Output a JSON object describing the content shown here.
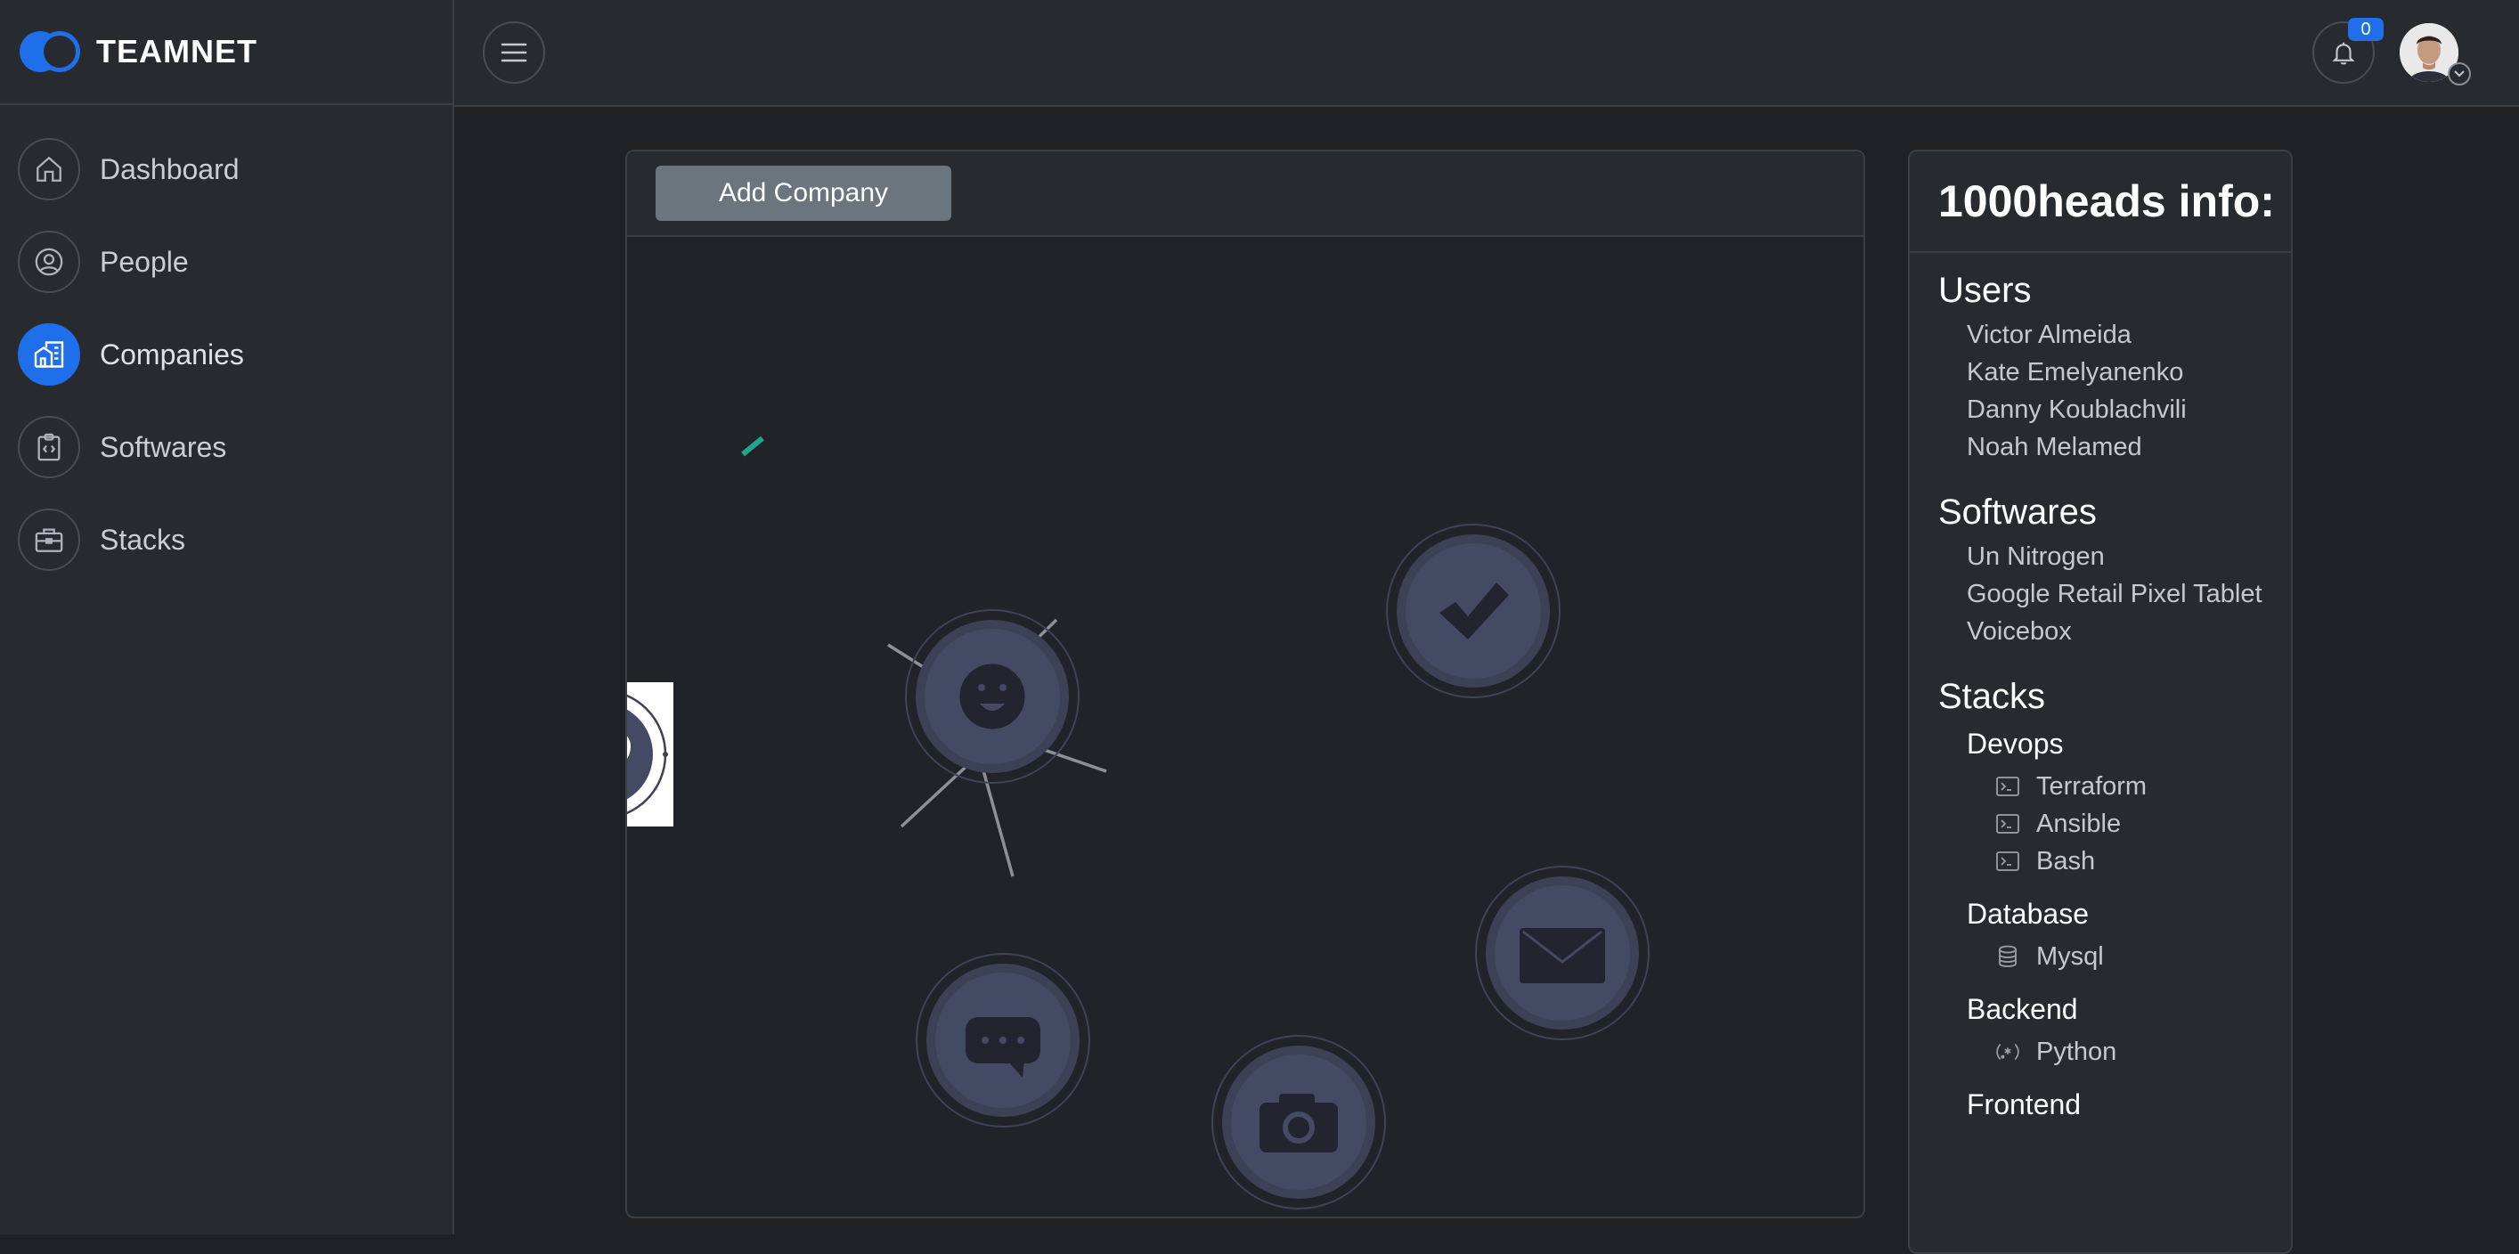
{
  "brand": {
    "name": "TEAMNET",
    "accent": "#1f6feb"
  },
  "sidebar": {
    "items": [
      {
        "label": "Dashboard",
        "icon": "home-icon",
        "active": false
      },
      {
        "label": "People",
        "icon": "user-circle-icon",
        "active": false
      },
      {
        "label": "Companies",
        "icon": "buildings-icon",
        "active": true
      },
      {
        "label": "Softwares",
        "icon": "code-clipboard-icon",
        "active": false
      },
      {
        "label": "Stacks",
        "icon": "briefcase-icon",
        "active": false
      }
    ]
  },
  "topbar": {
    "menu_icon": "hamburger-icon",
    "notifications": {
      "icon": "bell-icon",
      "count": "0"
    },
    "avatar": {
      "icon": "user-avatar-icon"
    }
  },
  "main": {
    "add_company_label": "Add Company",
    "graph": {
      "center_icon": "heart-icon",
      "nodes": [
        {
          "icon": "smile-icon"
        },
        {
          "icon": "check-icon"
        },
        {
          "icon": "mail-icon"
        },
        {
          "icon": "camera-icon"
        },
        {
          "icon": "chat-icon"
        }
      ]
    }
  },
  "info": {
    "title": "1000heads info:",
    "users_title": "Users",
    "users": [
      "Victor Almeida",
      "Kate Emelyanenko",
      "Danny Koublachvili",
      "Noah Melamed"
    ],
    "softwares_title": "Softwares",
    "softwares": [
      "Un Nitrogen",
      "Google Retail Pixel Tablet",
      "Voicebox"
    ],
    "stacks_title": "Stacks",
    "stacks": [
      {
        "name": "Devops",
        "items": [
          {
            "label": "Terraform",
            "icon": "terminal-icon"
          },
          {
            "label": "Ansible",
            "icon": "terminal-icon"
          },
          {
            "label": "Bash",
            "icon": "terminal-icon"
          }
        ]
      },
      {
        "name": "Database",
        "items": [
          {
            "label": "Mysql",
            "icon": "database-icon"
          }
        ]
      },
      {
        "name": "Backend",
        "items": [
          {
            "label": "Python",
            "icon": "regex-icon"
          }
        ]
      },
      {
        "name": "Frontend",
        "items": []
      }
    ]
  }
}
